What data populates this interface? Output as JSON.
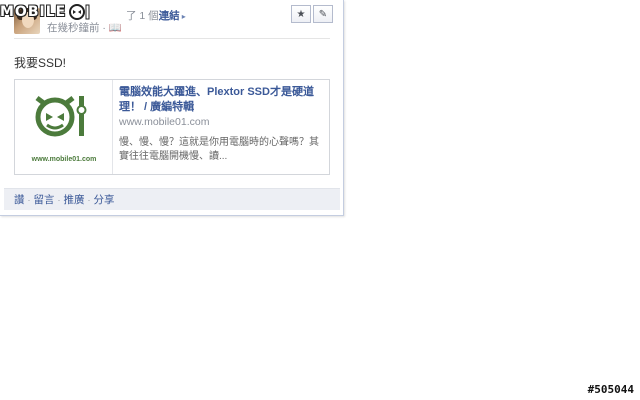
{
  "watermark": {
    "logo_text": "MOBILE",
    "post_id": "#505044"
  },
  "post": {
    "header_count": "了 1 個",
    "header_link": "連結",
    "timestamp": "在幾秒鐘前 · 📖",
    "status_text": "我要SSD!"
  },
  "controls": {
    "star_icon": "★",
    "edit_icon": "✎"
  },
  "link_preview": {
    "title": "電腦效能大躍進、Plextor SSD才是硬道理！ / 廣編特輯",
    "domain": "www.mobile01.com",
    "description": "慢、慢、慢？這就是你用電腦時的心聲嗎？其實往往電腦開機慢、讀...",
    "thumb_caption": "www.mobile01.com"
  },
  "actions": {
    "like": "讚",
    "comment": "留言",
    "promote": "推廣",
    "share": "分享",
    "separator": "·"
  },
  "colors": {
    "link": "#3b5998",
    "muted": "#8a8f99",
    "brand_green": "#4c7b3c",
    "bar_bg": "#edeff4"
  }
}
